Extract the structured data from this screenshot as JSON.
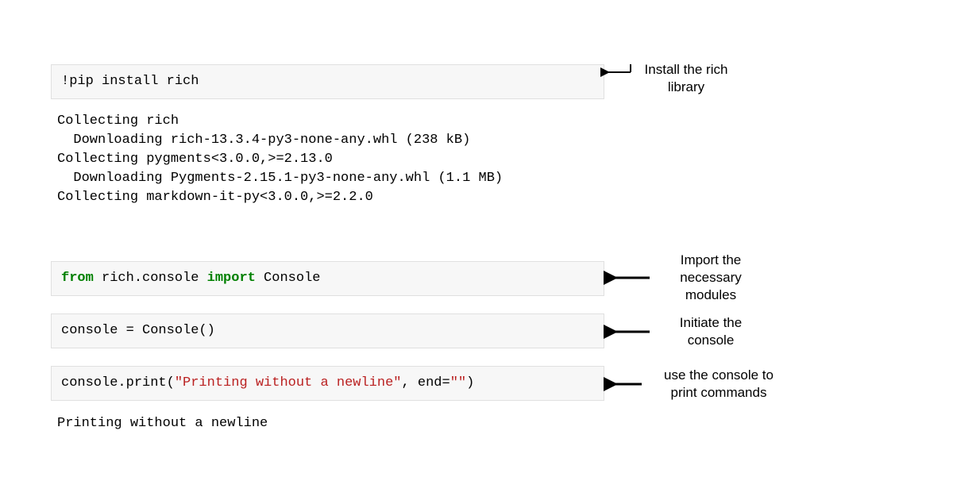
{
  "cells": {
    "install": {
      "code_plain": "!pip install rich",
      "output": "Collecting rich\n  Downloading rich-13.3.4-py3-none-any.whl (238 kB)\nCollecting pygments<3.0.0,>=2.13.0\n  Downloading Pygments-2.15.1-py3-none-any.whl (1.1 MB)\nCollecting markdown-it-py<3.0.0,>=2.2.0"
    },
    "import": {
      "kw_from": "from",
      "module": " rich.console ",
      "kw_import": "import",
      "target": " Console"
    },
    "init": {
      "code_plain": "console = Console()"
    },
    "print": {
      "prefix": "console.print(",
      "str1": "\"Printing without a newline\"",
      "mid": ", end=",
      "str2": "\"\"",
      "suffix": ")",
      "output": "Printing without a newline"
    }
  },
  "annotations": {
    "install": "Install the rich\nlibrary",
    "import": "Import the\nnecessary\nmodules",
    "init": "Initiate the\nconsole",
    "print": "use the console to\nprint commands"
  }
}
